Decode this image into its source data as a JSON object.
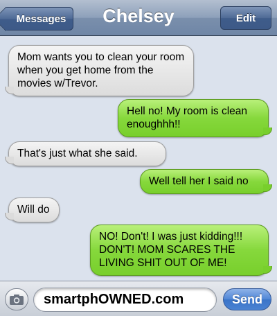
{
  "header": {
    "back_label": "Messages",
    "title": "Chelsey",
    "edit_label": "Edit"
  },
  "messages": [
    {
      "direction": "incoming",
      "text": "Mom wants you to clean your room when you get home from the movies w/Trevor."
    },
    {
      "direction": "outgoing",
      "text": "Hell no! My room is clean enoughhh!!"
    },
    {
      "direction": "incoming",
      "text": "That's just what she said."
    },
    {
      "direction": "outgoing",
      "text": "Well tell her I said no"
    },
    {
      "direction": "incoming",
      "text": "Will do"
    },
    {
      "direction": "outgoing",
      "text": "NO! Don't! I was just kidding!!! DON'T! MOM SCARES THE LIVING SHIT OUT OF ME!"
    }
  ],
  "composer": {
    "input_value": "smartphOWNED.com",
    "send_label": "Send",
    "camera_icon": "camera-icon"
  },
  "colors": {
    "incoming_bubble": "#e6e6e6",
    "outgoing_bubble": "#86d83c",
    "header": "#7a8fac",
    "send_button": "#4a82d2"
  }
}
